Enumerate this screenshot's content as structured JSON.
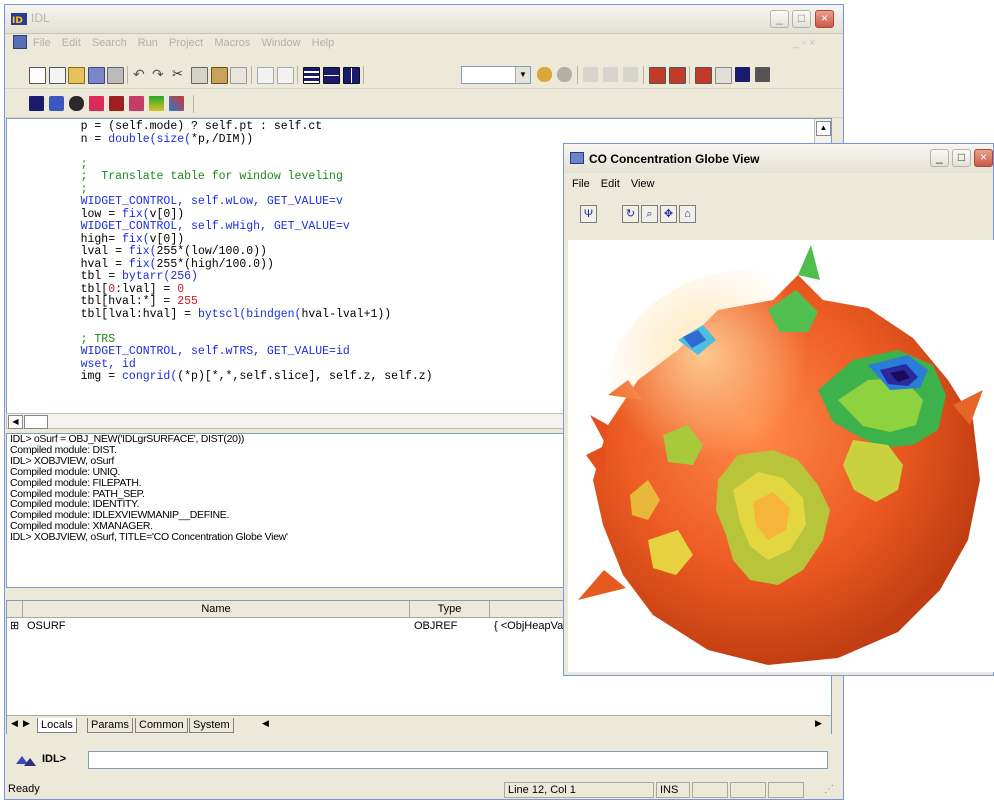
{
  "idl_window": {
    "title": "IDL",
    "menu": [
      "File",
      "Edit",
      "Search",
      "Run",
      "Project",
      "Macros",
      "Window",
      "Help"
    ]
  },
  "editor": {
    "lines": [
      {
        "parts": [
          {
            "t": "    p = (self.mode) ? self.pt : self.ct",
            "c": ""
          }
        ]
      },
      {
        "parts": [
          {
            "t": "    n = ",
            "c": ""
          },
          {
            "t": "double(size(",
            "c": "blue"
          },
          {
            "t": "*p,/DIM))",
            "c": ""
          }
        ]
      },
      {
        "parts": [
          {
            "t": "",
            "c": ""
          }
        ]
      },
      {
        "parts": [
          {
            "t": "    ;",
            "c": "comment"
          }
        ]
      },
      {
        "parts": [
          {
            "t": "    ;  Translate table for window leveling",
            "c": "comment"
          }
        ]
      },
      {
        "parts": [
          {
            "t": "    ;",
            "c": "comment"
          }
        ]
      },
      {
        "parts": [
          {
            "t": "    WIDGET_CONTROL, self.wLow, GET_VALUE=v",
            "c": "blue"
          }
        ]
      },
      {
        "parts": [
          {
            "t": "    low = ",
            "c": ""
          },
          {
            "t": "fix(",
            "c": "blue"
          },
          {
            "t": "v[0])",
            "c": ""
          }
        ]
      },
      {
        "parts": [
          {
            "t": "    WIDGET_CONTROL, self.wHigh, GET_VALUE=v",
            "c": "blue"
          }
        ]
      },
      {
        "parts": [
          {
            "t": "    high= ",
            "c": ""
          },
          {
            "t": "fix(",
            "c": "blue"
          },
          {
            "t": "v[0])",
            "c": ""
          }
        ]
      },
      {
        "parts": [
          {
            "t": "    lval = ",
            "c": ""
          },
          {
            "t": "fix(",
            "c": "blue"
          },
          {
            "t": "255*(low/100.0))",
            "c": ""
          }
        ]
      },
      {
        "parts": [
          {
            "t": "    hval = ",
            "c": ""
          },
          {
            "t": "fix(",
            "c": "blue"
          },
          {
            "t": "255*(high/100.0))",
            "c": ""
          }
        ]
      },
      {
        "parts": [
          {
            "t": "    tbl = ",
            "c": ""
          },
          {
            "t": "bytarr(256)",
            "c": "blue"
          }
        ]
      },
      {
        "parts": [
          {
            "t": "    tbl[",
            "c": ""
          },
          {
            "t": "0",
            "c": "red"
          },
          {
            "t": ":lval] = ",
            "c": ""
          },
          {
            "t": "0",
            "c": "red"
          }
        ]
      },
      {
        "parts": [
          {
            "t": "    tbl[hval:*] = ",
            "c": ""
          },
          {
            "t": "255",
            "c": "red"
          }
        ]
      },
      {
        "parts": [
          {
            "t": "    tbl[lval:hval] = ",
            "c": ""
          },
          {
            "t": "bytscl(bindgen(",
            "c": "blue"
          },
          {
            "t": "hval-lval+1))",
            "c": ""
          }
        ]
      },
      {
        "parts": [
          {
            "t": "",
            "c": ""
          }
        ]
      },
      {
        "parts": [
          {
            "t": "    ; TRS",
            "c": "comment"
          }
        ]
      },
      {
        "parts": [
          {
            "t": "    WIDGET_CONTROL, self.wTRS, GET_VALUE=id",
            "c": "blue"
          }
        ]
      },
      {
        "parts": [
          {
            "t": "    wset, id",
            "c": "blue"
          }
        ]
      },
      {
        "parts": [
          {
            "t": "    img = ",
            "c": ""
          },
          {
            "t": "congrid(",
            "c": "blue"
          },
          {
            "t": "(*p)[*,*,self.slice], self.z, self.z)",
            "c": ""
          }
        ]
      }
    ]
  },
  "output": [
    "IDL> oSurf = OBJ_NEW('IDLgrSURFACE', DIST(20))",
    "Compiled module: DIST.",
    "IDL> XOBJVIEW, oSurf",
    "Compiled module: UNIQ.",
    "Compiled module: FILEPATH.",
    "Compiled module: PATH_SEP.",
    "Compiled module: IDENTITY.",
    "Compiled module: IDLEXVIEWMANIP__DEFINE.",
    "Compiled module: XMANAGER.",
    "IDL> XOBJVIEW, oSurf, TITLE='CO Concentration Globe View'"
  ],
  "variables": {
    "headers": [
      "Name",
      "Type"
    ],
    "rows": [
      {
        "expand": "⊞",
        "name": "OSURF",
        "type": "OBJREF",
        "value": "{ <ObjHeapVa"
      }
    ],
    "tabs": [
      "Locals",
      "Params",
      "Common",
      "System"
    ]
  },
  "command": {
    "prompt": "IDL>",
    "value": ""
  },
  "status": {
    "ready": "Ready",
    "position": "Line 12, Col 1",
    "mode": "INS"
  },
  "globe_window": {
    "title": "CO Concentration Globe View",
    "menu": [
      "File",
      "Edit",
      "View"
    ]
  },
  "colors": {
    "accent": "#7a96df",
    "globe_base": "#e8501e",
    "comment": "#1a8a1a",
    "keyword": "#1b2de3",
    "number": "#d21c1c"
  }
}
